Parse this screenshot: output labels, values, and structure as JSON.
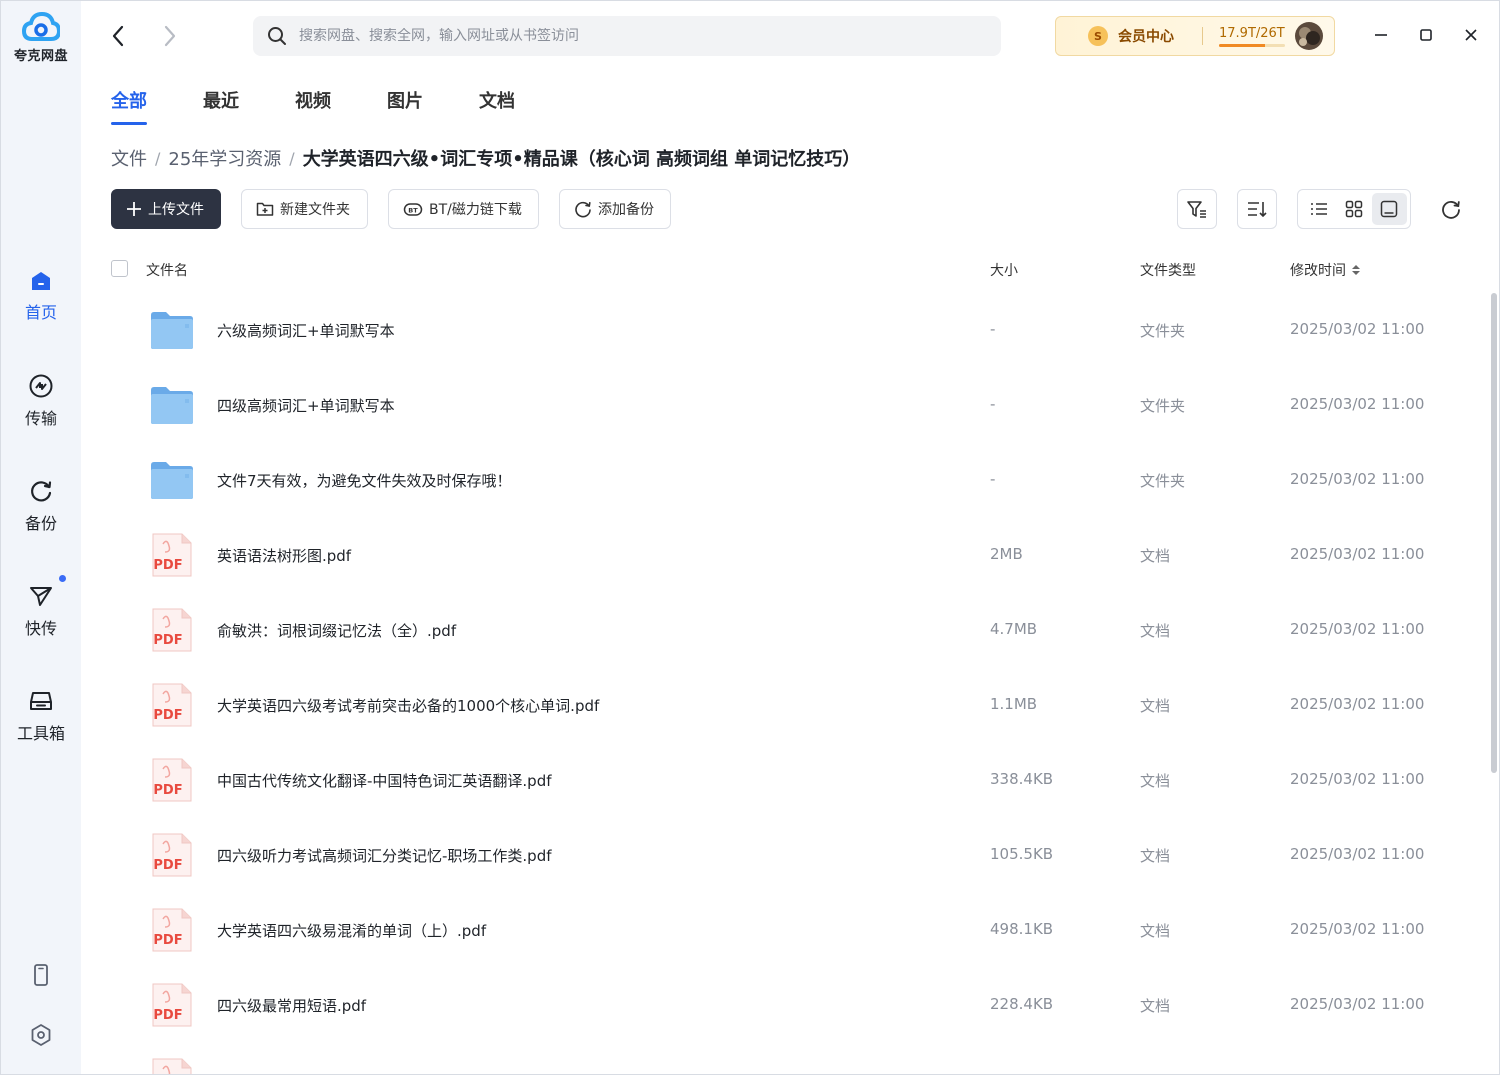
{
  "app": {
    "logo_text": "夸克网盘"
  },
  "sidebar": {
    "items": [
      {
        "label": "首页",
        "icon": "home-icon",
        "active": true
      },
      {
        "label": "传输",
        "icon": "transfer-icon"
      },
      {
        "label": "备份",
        "icon": "backup-icon"
      },
      {
        "label": "快传",
        "icon": "quick-send-icon",
        "badge": true
      },
      {
        "label": "工具箱",
        "icon": "toolbox-icon"
      }
    ],
    "bottom": [
      "phone-icon",
      "settings-icon"
    ]
  },
  "topbar": {
    "search_placeholder": "搜索网盘、搜索全网，输入网址或从书签访问",
    "vip_label": "会员中心",
    "storage_text": "17.9T/26T",
    "storage_used_fraction": 0.69
  },
  "tabs": [
    "全部",
    "最近",
    "视频",
    "图片",
    "文档"
  ],
  "breadcrumb": [
    "文件",
    "25年学习资源"
  ],
  "breadcrumb_current": "大学英语四六级•词汇专项•精品课（核心词 高频词组 单词记忆技巧）",
  "toolbar": {
    "upload": "上传文件",
    "new_folder": "新建文件夹",
    "bt": "BT/磁力链下载",
    "backup": "添加备份"
  },
  "table": {
    "headers": {
      "name": "文件名",
      "size": "大小",
      "type": "文件类型",
      "time": "修改时间"
    },
    "rows": [
      {
        "name": "六级高频词汇+单词默写本",
        "size": "-",
        "type": "文件夹",
        "time": "2025/03/02 11:00",
        "kind": "folder"
      },
      {
        "name": "四级高频词汇+单词默写本",
        "size": "-",
        "type": "文件夹",
        "time": "2025/03/02 11:00",
        "kind": "folder"
      },
      {
        "name": "文件7天有效，为避免文件失效及时保存哦！",
        "size": "-",
        "type": "文件夹",
        "time": "2025/03/02 11:00",
        "kind": "folder"
      },
      {
        "name": "英语语法树形图.pdf",
        "size": "2MB",
        "type": "文档",
        "time": "2025/03/02 11:00",
        "kind": "pdf"
      },
      {
        "name": "俞敏洪：词根词缀记忆法（全）.pdf",
        "size": "4.7MB",
        "type": "文档",
        "time": "2025/03/02 11:00",
        "kind": "pdf"
      },
      {
        "name": "大学英语四六级考试考前突击必备的1000个核心单词.pdf",
        "size": "1.1MB",
        "type": "文档",
        "time": "2025/03/02 11:00",
        "kind": "pdf"
      },
      {
        "name": "中国古代传统文化翻译-中国特色词汇英语翻译.pdf",
        "size": "338.4KB",
        "type": "文档",
        "time": "2025/03/02 11:00",
        "kind": "pdf"
      },
      {
        "name": "四六级听力考试高频词汇分类记忆-职场工作类.pdf",
        "size": "105.5KB",
        "type": "文档",
        "time": "2025/03/02 11:00",
        "kind": "pdf"
      },
      {
        "name": "大学英语四六级易混淆的单词（上）.pdf",
        "size": "498.1KB",
        "type": "文档",
        "time": "2025/03/02 11:00",
        "kind": "pdf"
      },
      {
        "name": "四六级最常用短语.pdf",
        "size": "228.4KB",
        "type": "文档",
        "time": "2025/03/02 11:00",
        "kind": "pdf"
      },
      {
        "name": "",
        "size": "",
        "type": "",
        "time": "",
        "kind": "pdf"
      }
    ]
  },
  "icon_labels": {
    "pdf": "PDF",
    "vip": "S"
  },
  "colors": {
    "accent": "#2563eb",
    "primary_button": "#2d3342",
    "folder": "#7fb8f0",
    "pdf_red": "#e84a3f"
  }
}
